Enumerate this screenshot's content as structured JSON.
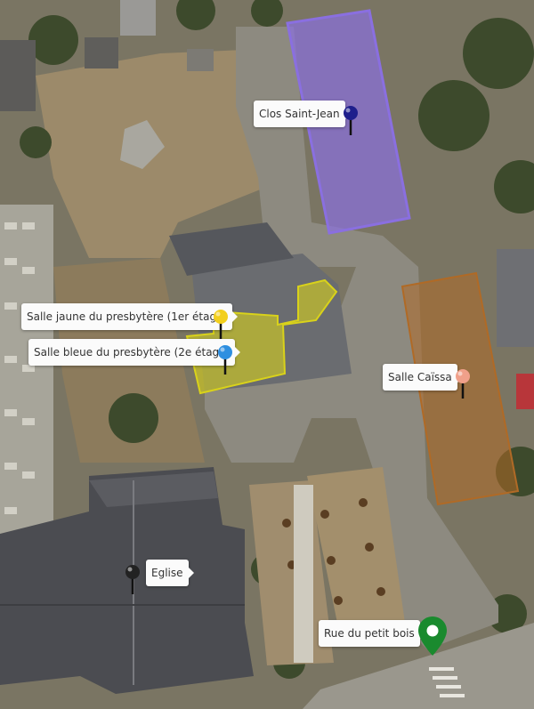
{
  "markers": [
    {
      "id": "clos-saint-jean",
      "label": "Clos Saint-Jean",
      "color": "#1f1f8c",
      "icon": "pushpin-icon"
    },
    {
      "id": "salle-jaune",
      "label": "Salle jaune du presbytère (1er étage)",
      "color": "#f2cf1d",
      "icon": "pushpin-icon"
    },
    {
      "id": "salle-bleue",
      "label": "Salle bleue du presbytère (2e étage)",
      "color": "#2e8fe0",
      "icon": "pushpin-icon"
    },
    {
      "id": "salle-caissa",
      "label": "Salle Caïssa",
      "color": "#f0a08a",
      "icon": "pushpin-icon"
    },
    {
      "id": "eglise",
      "label": "Eglise",
      "color": "#222222",
      "icon": "pushpin-icon"
    },
    {
      "id": "rue-du-petit-bois",
      "label": "Rue du petit bois",
      "color": "#1a8a2e",
      "icon": "map-pin-icon"
    }
  ],
  "areas": {
    "clos_saint_jean": "#8a6fe0",
    "salle_jaune": "#d9d21a",
    "salle_caissa": "#b06a26"
  }
}
